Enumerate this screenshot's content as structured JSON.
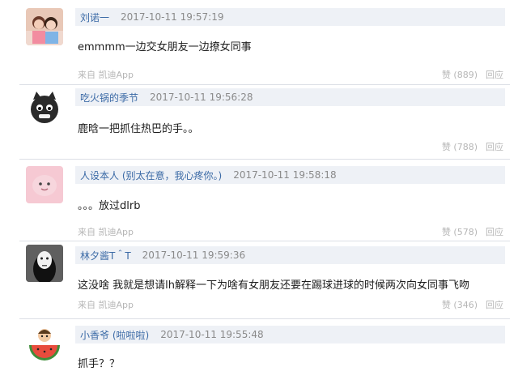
{
  "comments": [
    {
      "user": "刘诺一",
      "time": "2017-10-11 19:57:19",
      "text": "emmmm一边交女朋友一边撩女同事",
      "source": "来自 凯迪App",
      "likes": "赞 (889)",
      "reply": "回应",
      "avatar": "couple-photo"
    },
    {
      "user": "吃火锅的季节",
      "time": "2017-10-11 19:56:28",
      "text": "鹿晗一把抓住热巴的手。。",
      "source": "",
      "likes": "赞 (788)",
      "reply": "回应",
      "avatar": "black-kitten"
    },
    {
      "user": "人设本人 (别太在意，我心疼你。)",
      "time": "2017-10-11 19:58:18",
      "text": "。。。放过dlrb",
      "source": "来自 凯迪App",
      "likes": "赞 (578)",
      "reply": "回应",
      "avatar": "pink-blob"
    },
    {
      "user": "林夕酱T＾T",
      "time": "2017-10-11 19:59:36",
      "text": "这没啥 我就是想请lh解释一下为啥有女朋友还要在踢球进球的时候两次向女同事飞吻",
      "source": "来自 凯迪App",
      "likes": "赞 (346)",
      "reply": "回应",
      "avatar": "no-face"
    },
    {
      "user": "小香爷 (啦啦啦)",
      "time": "2017-10-11 19:55:48",
      "text": "抓手？？",
      "source": "",
      "likes": "",
      "reply": "",
      "avatar": "watermelon-character"
    }
  ]
}
